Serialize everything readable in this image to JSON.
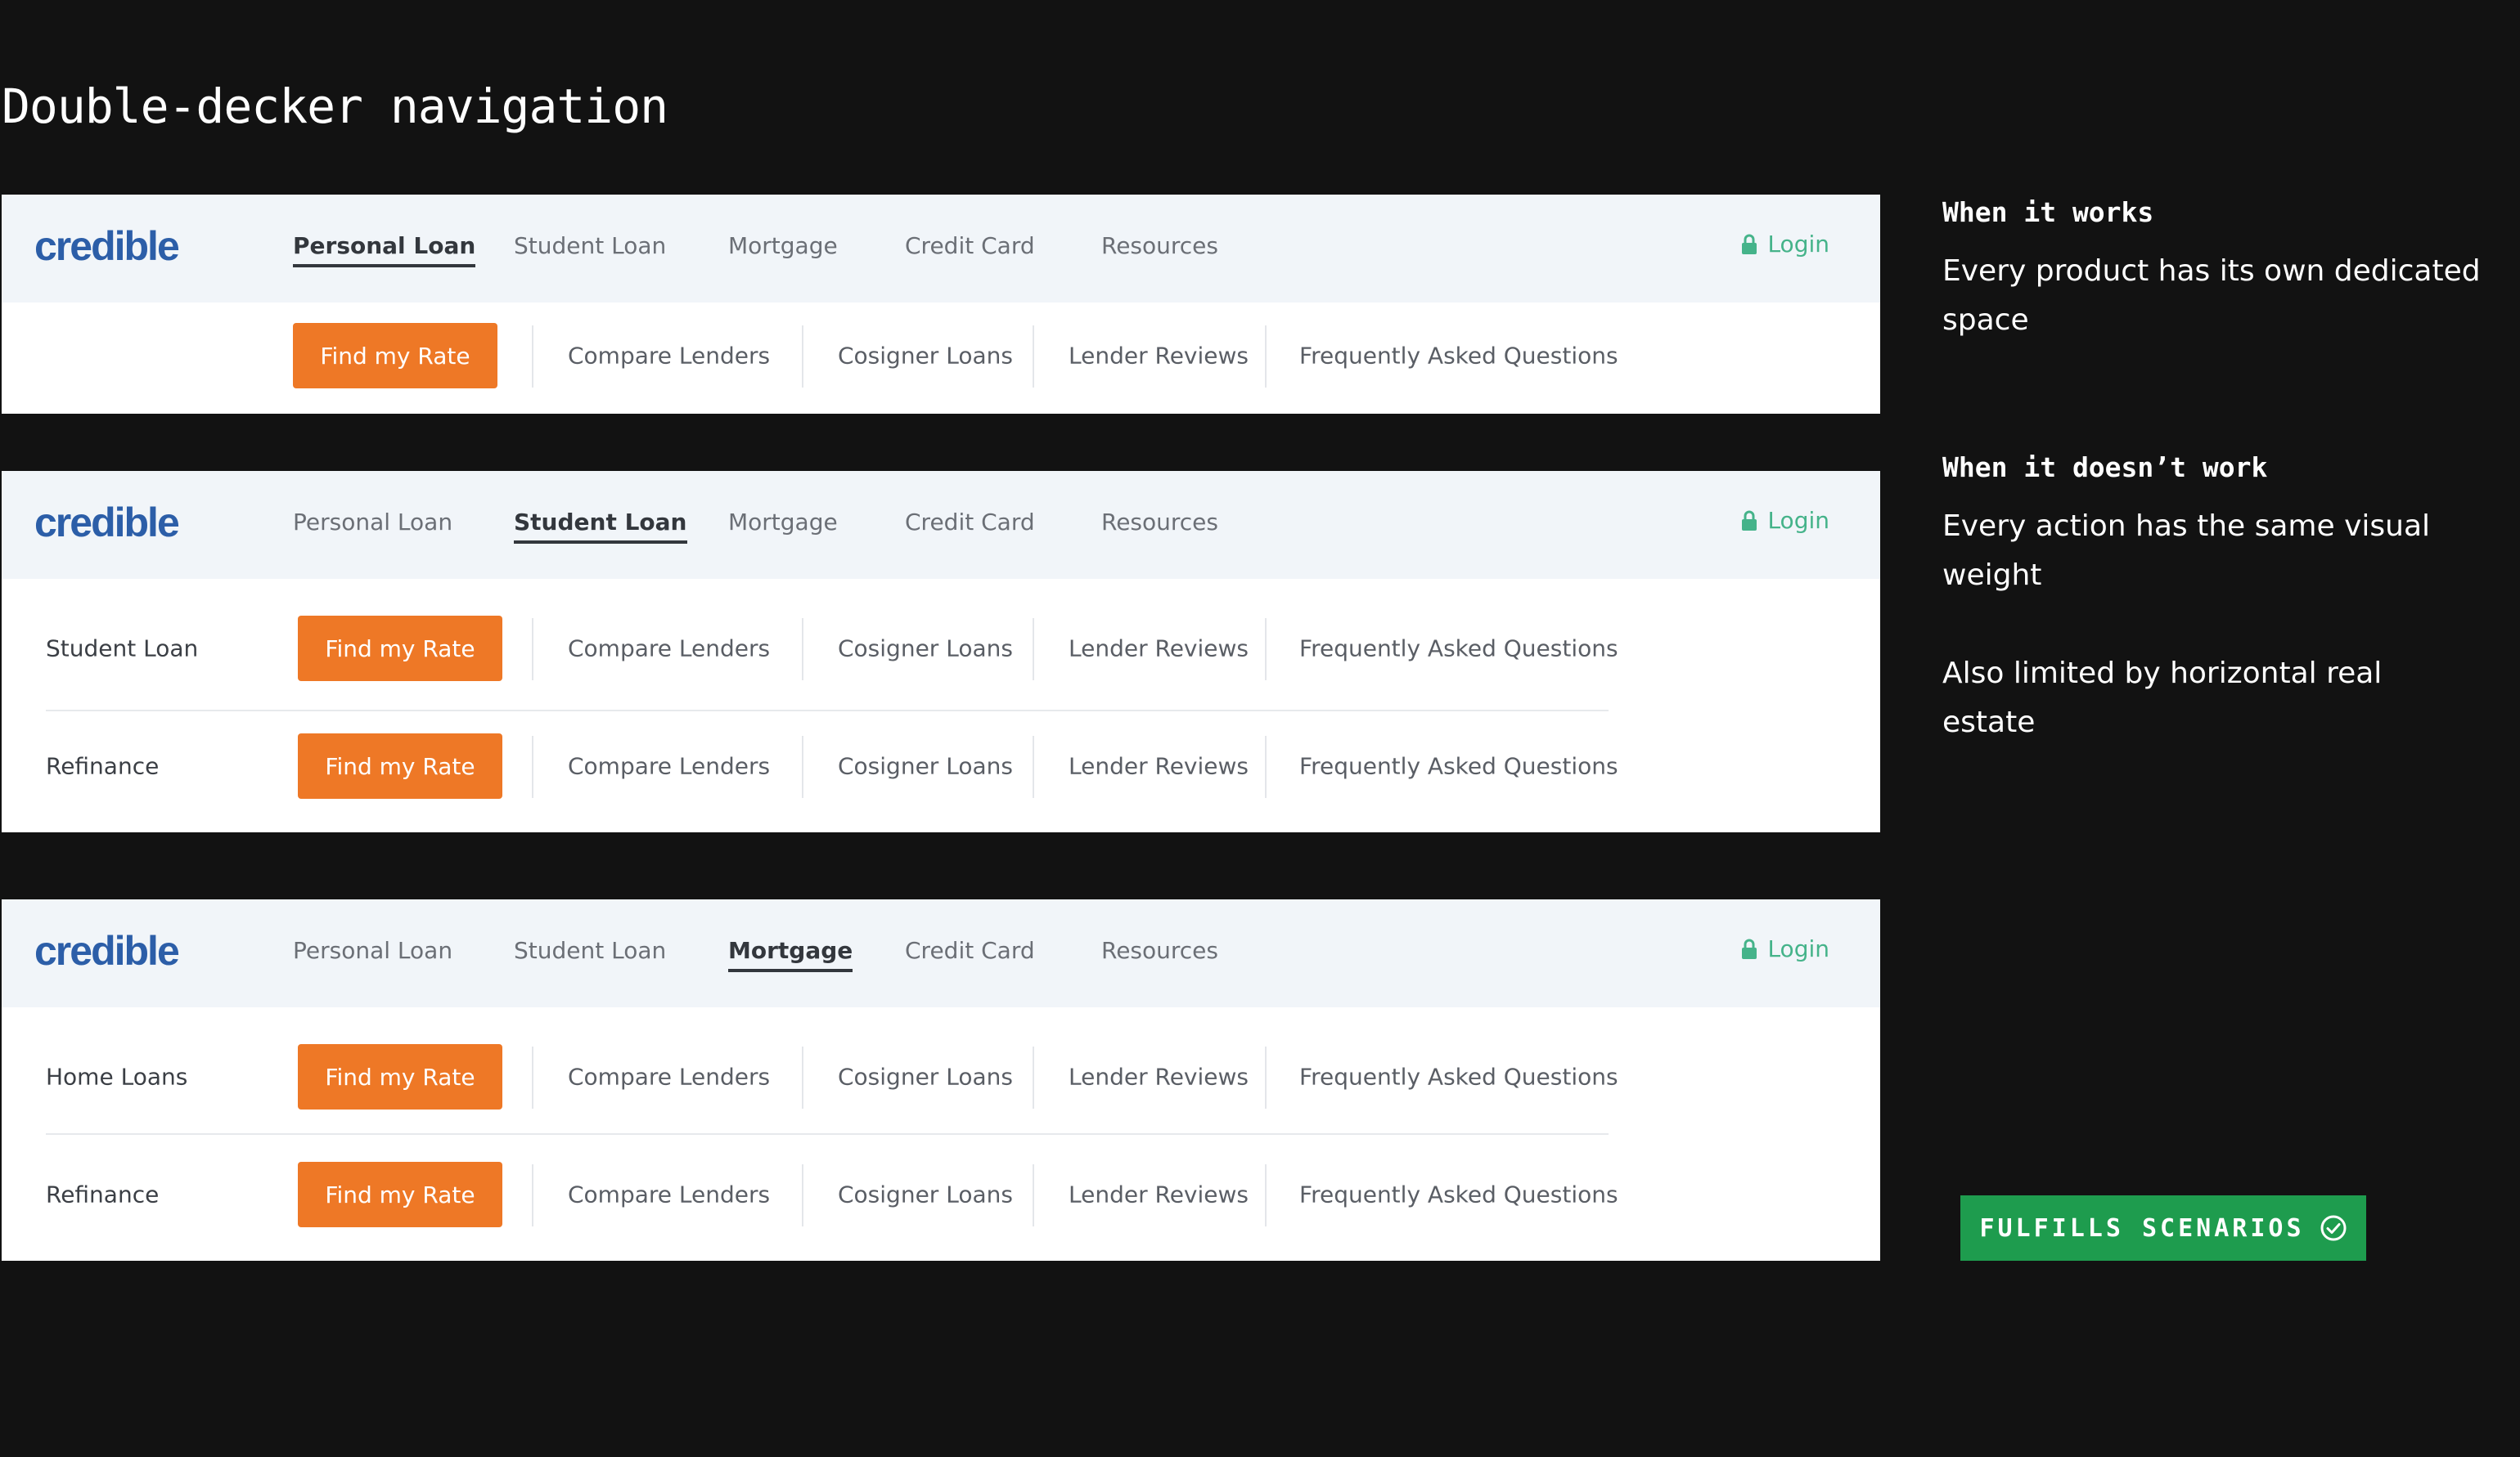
{
  "page": {
    "title": "Double-decker navigation"
  },
  "brand": {
    "logo_text": "credible"
  },
  "nav": {
    "items": [
      "Personal Loan",
      "Student Loan",
      "Mortgage",
      "Credit Card",
      "Resources"
    ],
    "login_label": "Login"
  },
  "subnav": {
    "button_label": "Find my Rate",
    "links": [
      "Compare Lenders",
      "Cosigner Loans",
      "Lender Reviews",
      "Frequently Asked Questions"
    ]
  },
  "panels": [
    {
      "active_tab": "Personal Loan",
      "rows": [
        {
          "label": ""
        }
      ]
    },
    {
      "active_tab": "Student Loan",
      "rows": [
        {
          "label": "Student Loan"
        },
        {
          "label": "Refinance"
        }
      ]
    },
    {
      "active_tab": "Mortgage",
      "rows": [
        {
          "label": "Home Loans"
        },
        {
          "label": "Refinance"
        }
      ]
    }
  ],
  "notes": {
    "works_heading": "When it works",
    "works_text": "Every product has its own dedicated space",
    "doesnt_heading": "When it doesn’t work",
    "doesnt_text": "Every action has the same visual weight",
    "extra_text": "Also limited by horizontal real estate"
  },
  "badge": {
    "label": "FULFILLS SCENARIOS"
  },
  "colors": {
    "background": "#121212",
    "brand_blue": "#2c5ea8",
    "accent_orange": "#ee7826",
    "login_green": "#45b38a",
    "badge_green": "#1e9c4e"
  },
  "icons": {
    "login": "lock-icon",
    "badge": "check-circle-icon"
  }
}
